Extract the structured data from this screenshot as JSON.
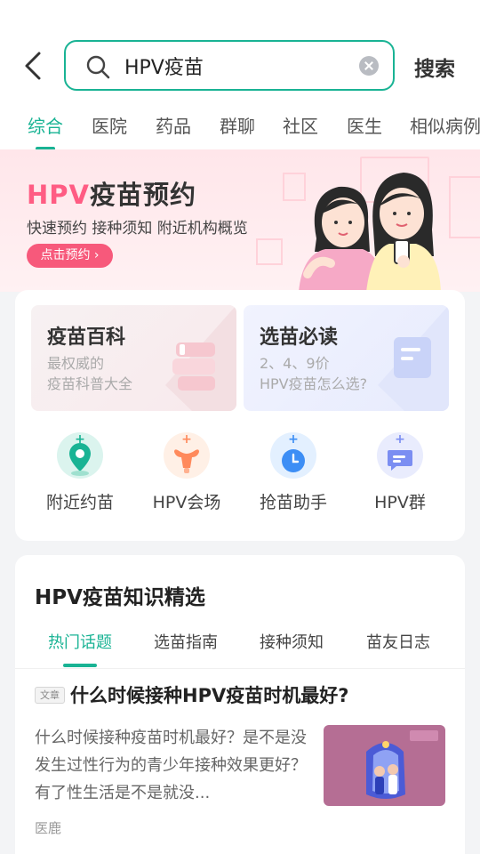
{
  "search": {
    "query": "HPV疫苗",
    "button_label": "搜索"
  },
  "tabs": [
    {
      "label": "综合",
      "active": true
    },
    {
      "label": "医院"
    },
    {
      "label": "药品"
    },
    {
      "label": "群聊"
    },
    {
      "label": "社区"
    },
    {
      "label": "医生"
    },
    {
      "label": "相似病例"
    }
  ],
  "banner": {
    "title_highlight": "HPV",
    "title_rest": "疫苗预约",
    "subtitle": "快速预约 接种须知 附近机构概览",
    "button_label": "点击预约 ›"
  },
  "tiles": [
    {
      "title": "疫苗百科",
      "desc": "最权威的\n疫苗科普大全"
    },
    {
      "title": "选苗必读",
      "desc": "2、4、9价\nHPV疫苗怎么选?"
    }
  ],
  "quick_icons": [
    {
      "label": "附近约苗",
      "icon": "location-pin-icon",
      "color": "#19b394"
    },
    {
      "label": "HPV会场",
      "icon": "uterus-icon",
      "color": "#ff8a5c"
    },
    {
      "label": "抢苗助手",
      "icon": "clock-icon",
      "color": "#3d8ef5"
    },
    {
      "label": "HPV群",
      "icon": "chat-group-icon",
      "color": "#7b8ef2"
    }
  ],
  "knowledge": {
    "title": "HPV疫苗知识精选",
    "tabs": [
      {
        "label": "热门话题",
        "active": true
      },
      {
        "label": "选苗指南"
      },
      {
        "label": "接种须知"
      },
      {
        "label": "苗友日志"
      }
    ],
    "article": {
      "tag": "文章",
      "title": "什么时候接种HPV疫苗时机最好?",
      "body": "什么时候接种疫苗时机最好？是不是没发生过性行为的青少年接种效果更好？有了性生活是不是就没...",
      "source": "医鹿"
    }
  }
}
